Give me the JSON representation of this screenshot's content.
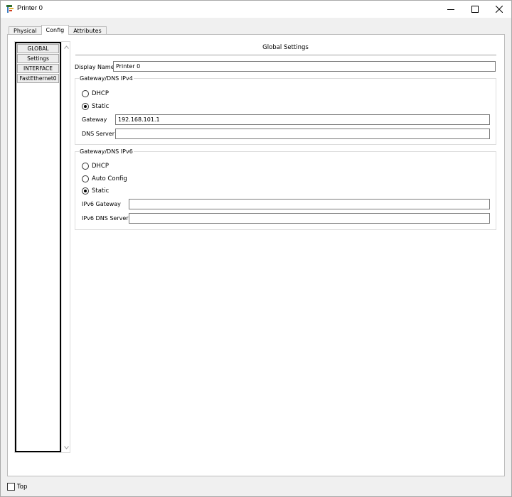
{
  "window": {
    "title": "Printer 0",
    "controls": {
      "minimize_icon": "minimize-icon",
      "maximize_icon": "maximize-icon",
      "close_icon": "close-icon"
    }
  },
  "tabs": [
    {
      "label": "Physical",
      "active": false
    },
    {
      "label": "Config",
      "active": true
    },
    {
      "label": "Attributes",
      "active": false
    }
  ],
  "sidebar": {
    "items": [
      {
        "label": "GLOBAL"
      },
      {
        "label": "Settings"
      },
      {
        "label": "INTERFACE"
      },
      {
        "label": "FastEthernet0"
      }
    ]
  },
  "global_settings": {
    "title": "Global Settings",
    "display_name_label": "Display Name",
    "display_name_value": "Printer 0"
  },
  "ipv4": {
    "group_label": "Gateway/DNS IPv4",
    "dhcp_label": "DHCP",
    "static_label": "Static",
    "selected": "Static",
    "gateway_label": "Gateway",
    "gateway_value": "192.168.101.1",
    "dns_label": "DNS Server",
    "dns_value": ""
  },
  "ipv6": {
    "group_label": "Gateway/DNS IPv6",
    "dhcp_label": "DHCP",
    "auto_label": "Auto Config",
    "static_label": "Static",
    "selected": "Static",
    "gateway_label": "IPv6 Gateway",
    "gateway_value": "",
    "dns_label": "IPv6 DNS Server",
    "dns_value": ""
  },
  "footer": {
    "top_label": "Top",
    "top_checked": false
  }
}
